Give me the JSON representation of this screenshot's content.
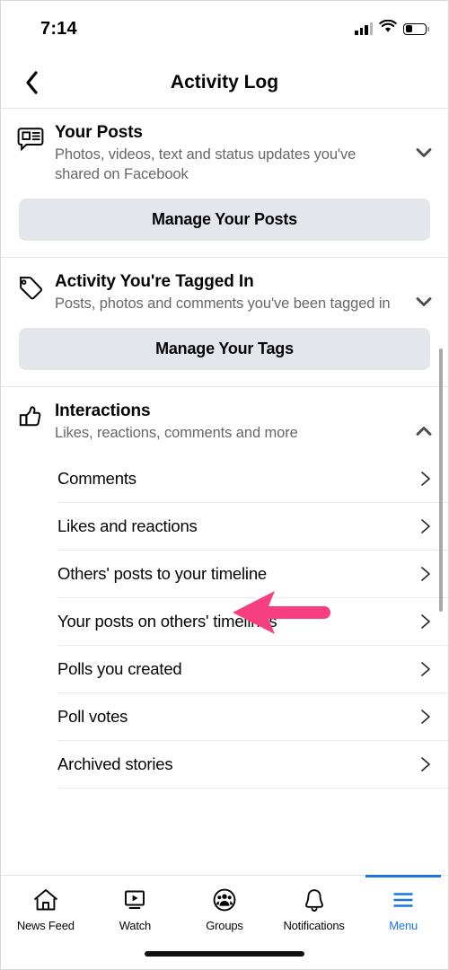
{
  "status_bar": {
    "time": "7:14",
    "signal_icon": "cellular-signal-icon",
    "wifi_icon": "wifi-icon",
    "battery_icon": "battery-icon"
  },
  "nav": {
    "back_icon": "chevron-left-icon",
    "title": "Activity Log"
  },
  "sections": [
    {
      "id": "your-posts",
      "icon": "post-bubble-icon",
      "title": "Your Posts",
      "subtitle": "Photos, videos, text and status updates you've shared on Facebook",
      "toggle_icon": "chevron-down-icon",
      "expanded": false,
      "button_label": "Manage Your Posts"
    },
    {
      "id": "activity-tagged-in",
      "icon": "tag-icon",
      "title": "Activity You're Tagged In",
      "subtitle": "Posts, photos and comments you've been tagged in",
      "toggle_icon": "chevron-down-icon",
      "expanded": false,
      "button_label": "Manage Your Tags"
    },
    {
      "id": "interactions",
      "icon": "thumbs-up-icon",
      "title": "Interactions",
      "subtitle": "Likes, reactions, comments and more",
      "toggle_icon": "chevron-up-icon",
      "expanded": true,
      "items": [
        {
          "label": "Comments",
          "chevron": "chevron-right-icon"
        },
        {
          "label": "Likes and reactions",
          "chevron": "chevron-right-icon",
          "annotated": true
        },
        {
          "label": "Others' posts to your timeline",
          "chevron": "chevron-right-icon"
        },
        {
          "label": "Your posts on others' timelines",
          "chevron": "chevron-right-icon"
        },
        {
          "label": "Polls you created",
          "chevron": "chevron-right-icon"
        },
        {
          "label": "Poll votes",
          "chevron": "chevron-right-icon"
        },
        {
          "label": "Archived stories",
          "chevron": "chevron-right-icon"
        }
      ]
    }
  ],
  "annotation": {
    "type": "arrow-left",
    "color": "#f73f7f",
    "points_at": "Likes and reactions"
  },
  "tab_bar": {
    "items": [
      {
        "label": "News Feed",
        "icon": "home-icon",
        "active": false
      },
      {
        "label": "Watch",
        "icon": "video-play-icon",
        "active": false
      },
      {
        "label": "Groups",
        "icon": "groups-people-icon",
        "active": false
      },
      {
        "label": "Notifications",
        "icon": "bell-icon",
        "active": false
      },
      {
        "label": "Menu",
        "icon": "hamburger-menu-icon",
        "active": true
      }
    ],
    "active_color": "#1b74e4"
  },
  "colors": {
    "accent_blue": "#1b74e4",
    "annotation_pink": "#f73f7f",
    "button_bg": "#e4e6eb",
    "text_primary": "#050505",
    "text_secondary": "#65676b",
    "divider": "#e4e6e9"
  }
}
